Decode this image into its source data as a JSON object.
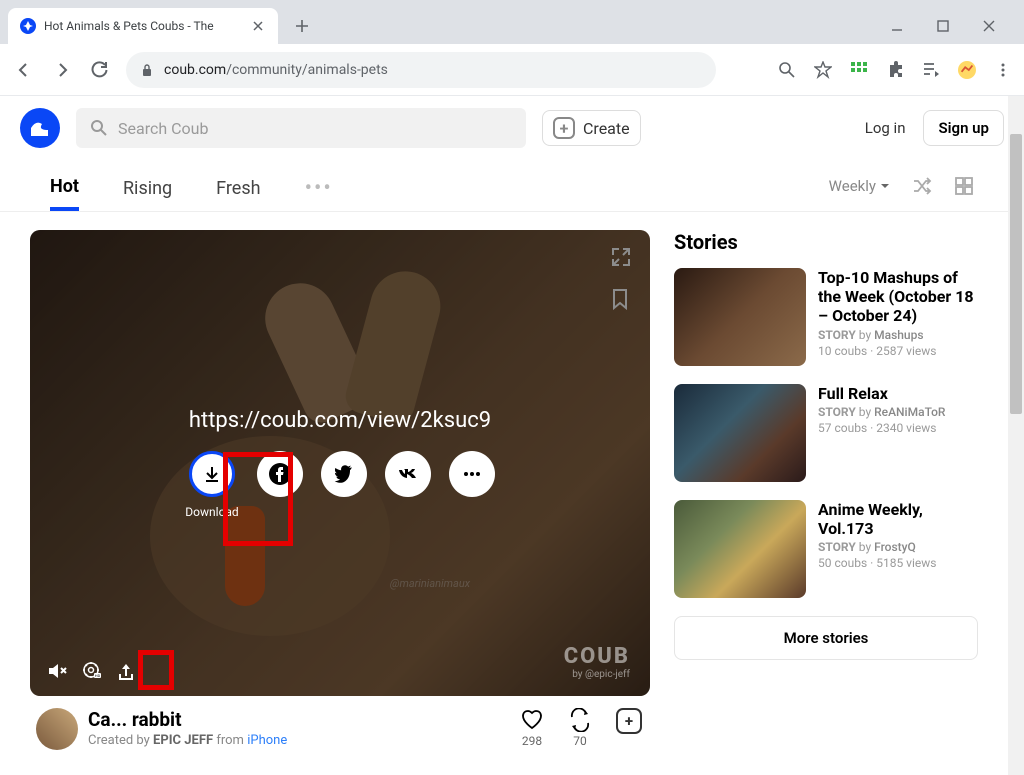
{
  "browser": {
    "tab_title": "Hot Animals & Pets Coubs - The",
    "url_domain": "coub.com",
    "url_path": "/community/animals-pets"
  },
  "header": {
    "search_placeholder": "Search Coub",
    "create_label": "Create",
    "login_label": "Log in",
    "signup_label": "Sign up"
  },
  "tabs": {
    "hot": "Hot",
    "rising": "Rising",
    "fresh": "Fresh",
    "weekly": "Weekly"
  },
  "share": {
    "url": "https://coub.com/view/2ksuc9",
    "download_label": "Download"
  },
  "watermark": {
    "artist": "@marinianimaux",
    "brand": "COUB",
    "credit": "by @epic-jeff"
  },
  "video": {
    "title": "Ca... rabbit",
    "created_by_prefix": "Created by",
    "author": "EPIC JEFF",
    "from": "from",
    "device": "iPhone",
    "likes": "298",
    "recoubs": "70"
  },
  "stories": {
    "heading": "Stories",
    "more": "More stories",
    "items": [
      {
        "title": "Top-10 Mashups of the Week (October 18 – October 24)",
        "author": "Mashups",
        "stats": "10 coubs · 2587 views"
      },
      {
        "title": "Full Relax",
        "author": "ReANiMaToR",
        "stats": "57 coubs · 2340 views"
      },
      {
        "title": "Anime Weekly, Vol.173",
        "author": "FrostyQ",
        "stats": "50 coubs · 5185 views"
      }
    ],
    "story_word": "STORY",
    "by_word": "by"
  }
}
